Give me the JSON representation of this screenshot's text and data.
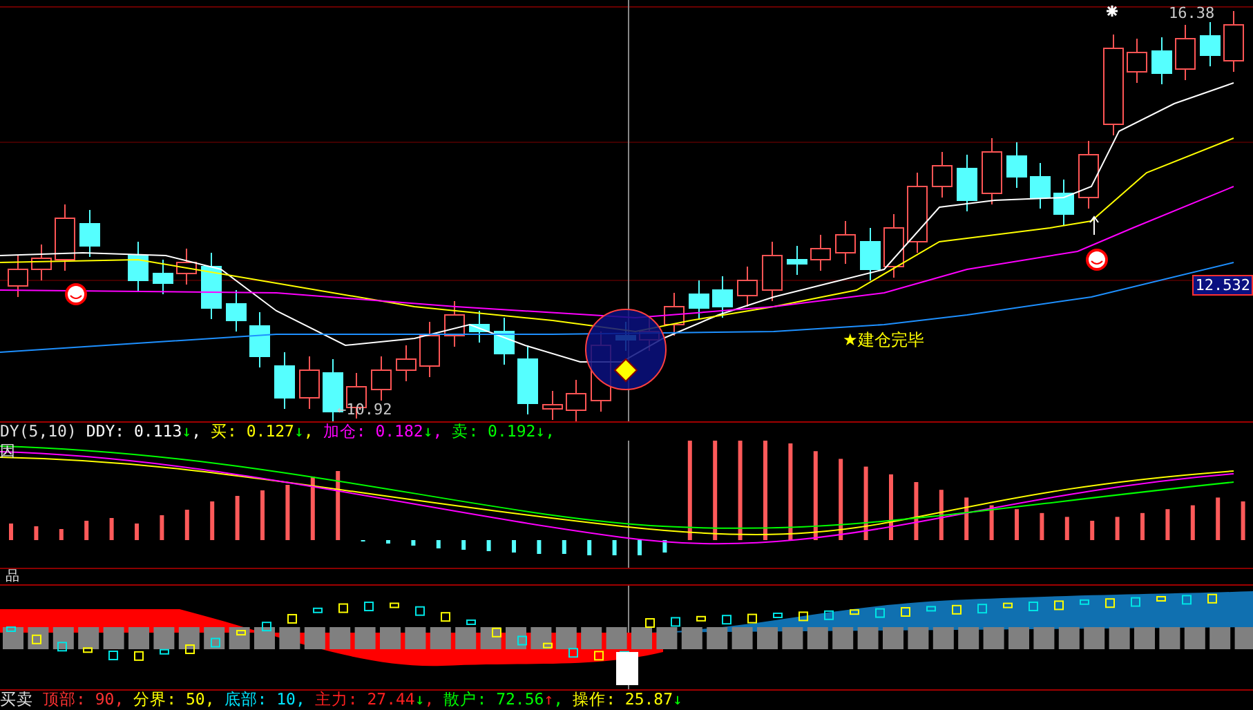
{
  "price_panel": {
    "high_label": "16.38",
    "low_label": "←10.92",
    "last_price": "12.532",
    "signal_label": "★建仓完毕"
  },
  "ddy_legend": [
    {
      "text": "DY(5,10)",
      "color": "#e0e0e0"
    },
    {
      "text": "DDY: 0.113",
      "arrow": {
        "text": "↓",
        "color": "#00ff00"
      },
      "tail": ",",
      "color": "#ffffff"
    },
    {
      "text": "买: 0.127",
      "arrow": {
        "text": "↓",
        "color": "#00ff00"
      },
      "tail": ",",
      "color": "#ffff00"
    },
    {
      "text": "加仓: 0.182",
      "arrow": {
        "text": "↓",
        "color": "#00ff00"
      },
      "tail": ",",
      "color": "#ff00ff"
    },
    {
      "text": "卖: 0.192",
      "arrow": {
        "text": "↓",
        "color": "#00ff00"
      },
      "tail": ",",
      "color": "#00ff00"
    }
  ],
  "momentum_panel": {
    "title": "因"
  },
  "product_panel": {
    "title": "品"
  },
  "trade_legend": [
    {
      "text": "买卖",
      "color": "#e0e0e0"
    },
    {
      "text": "顶部: 90,",
      "color": "#ff3232"
    },
    {
      "text": "分界: 50,",
      "color": "#ffff00"
    },
    {
      "text": "底部: 10,",
      "color": "#00e5ff"
    },
    {
      "text": "主力: 27.44",
      "arrow": {
        "text": "↓",
        "color": "#00ff00"
      },
      "tail": ",",
      "color": "#ff2020"
    },
    {
      "text": "散户: 72.56",
      "arrow": {
        "text": "↑",
        "color": "#ff2020"
      },
      "tail": ",",
      "color": "#00ff00"
    },
    {
      "text": "操作: 25.87",
      "arrow": {
        "text": "↓",
        "color": "#00ff00"
      },
      "color": "#ffff00"
    }
  ]
}
